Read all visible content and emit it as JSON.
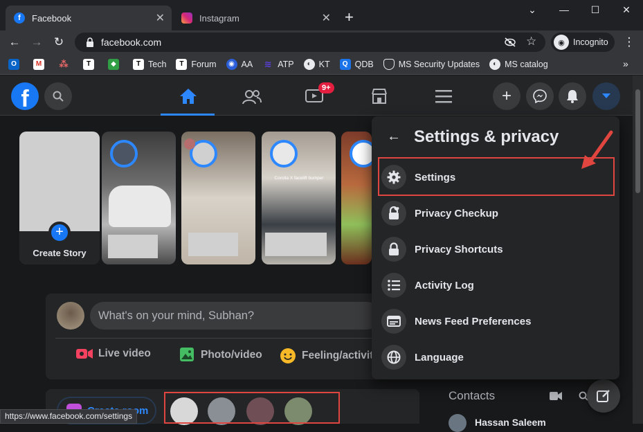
{
  "browser": {
    "tabs": [
      {
        "title": "Facebook"
      },
      {
        "title": "Instagram"
      }
    ],
    "new_tab": "+",
    "window": {
      "minimize": "—",
      "maximize": "☐",
      "close": "✕",
      "chevron": "⌄"
    },
    "url": "facebook.com",
    "incognito_label": "Incognito",
    "bookmarks": [
      {
        "label": ""
      },
      {
        "label": ""
      },
      {
        "label": ""
      },
      {
        "label": ""
      },
      {
        "label": ""
      },
      {
        "label": "Tech"
      },
      {
        "label": "Forum"
      },
      {
        "label": "AA"
      },
      {
        "label": "ATP"
      },
      {
        "label": "KT"
      },
      {
        "label": "QDB"
      },
      {
        "label": "MS Security Updates"
      },
      {
        "label": "MS catalog"
      }
    ],
    "bookmarks_overflow": "»",
    "status_url": "https://www.facebook.com/settings"
  },
  "header": {
    "video_badge": "9+"
  },
  "stories": {
    "create_label": "Create Story",
    "story3_caption": "Corolla X facelift bumper"
  },
  "composer": {
    "placeholder": "What's on your mind, Subhan?",
    "live": "Live video",
    "photo": "Photo/video",
    "feeling": "Feeling/activity"
  },
  "menu": {
    "title": "Settings & privacy",
    "back": "←",
    "items": [
      {
        "label": "Settings"
      },
      {
        "label": "Privacy Checkup"
      },
      {
        "label": "Privacy Shortcuts"
      },
      {
        "label": "Activity Log"
      },
      {
        "label": "News Feed Preferences"
      },
      {
        "label": "Language"
      }
    ]
  },
  "sidebar": {
    "contacts_title": "Contacts",
    "contact_partial": "Hassan Saleem"
  },
  "rooms": {
    "create_partial": "Create room"
  },
  "colors": {
    "fb_blue": "#1877f2",
    "highlight": "#e0463f",
    "dark_bg": "#18191a"
  }
}
